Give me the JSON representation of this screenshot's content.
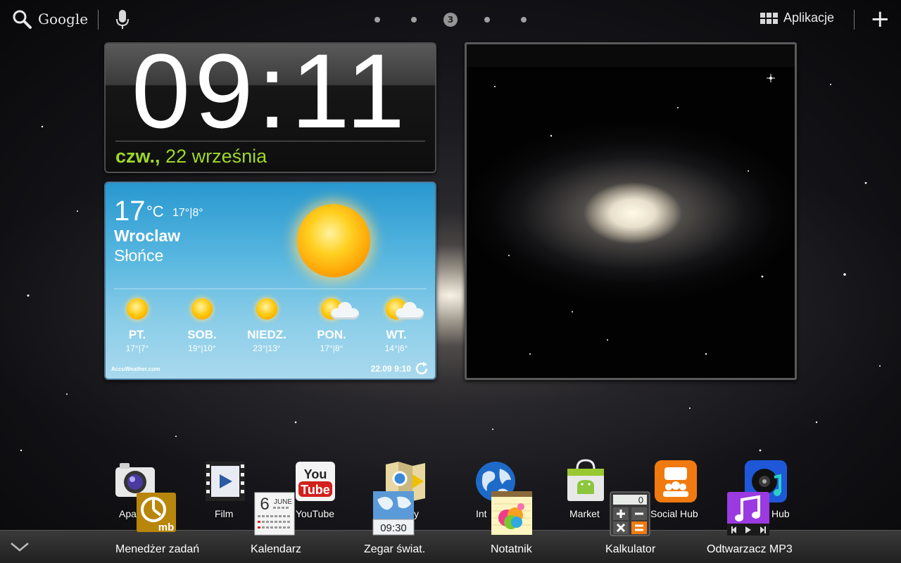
{
  "topbar": {
    "search_label": "Google",
    "page_indicator": "3",
    "apps_label": "Aplikacje",
    "add_label": "+"
  },
  "clock": {
    "time": "09:11",
    "day": "czw.,",
    "date": "22 września"
  },
  "weather": {
    "temp": "17",
    "unit": "°C",
    "hi_lo": "17°|8°",
    "city": "Wroclaw",
    "condition": "Słońce",
    "forecast": [
      {
        "day": "PT.",
        "temps": "17°|7°",
        "icon": "sunny-icon"
      },
      {
        "day": "SOB.",
        "temps": "19°|10°",
        "icon": "sunny-icon"
      },
      {
        "day": "NIEDZ.",
        "temps": "23°|13°",
        "icon": "sunny-icon"
      },
      {
        "day": "PON.",
        "temps": "17°|8°",
        "icon": "partly-cloudy-icon"
      },
      {
        "day": "WT.",
        "temps": "14°|6°",
        "icon": "partly-cloudy-icon"
      }
    ],
    "brand": "AccuWeather.com",
    "updated": "22.09 9:10"
  },
  "dock": {
    "row1": [
      {
        "label": "Apa",
        "icon": "camera-icon"
      },
      {
        "label": "Film",
        "icon": "video-icon"
      },
      {
        "label": "YouTube",
        "icon": "youtube-icon"
      },
      {
        "label": "y",
        "icon": "maps-icon"
      },
      {
        "label": "Int",
        "icon": "internet-icon"
      },
      {
        "label": "Market",
        "icon": "market-icon"
      },
      {
        "label": "Social Hub",
        "icon": "social-hub-icon"
      },
      {
        "label": "Hub",
        "icon": "music-hub-icon"
      }
    ],
    "row2": [
      {
        "label": "Menedżer zadań",
        "icon": "task-manager-icon",
        "icon_text": "mb"
      },
      {
        "label": "Kalendarz",
        "icon": "calendar-icon",
        "icon_day": "6",
        "icon_month": "JUNE"
      },
      {
        "label": "Zegar świat.",
        "icon": "world-clock-icon",
        "icon_time": "09:30"
      },
      {
        "label": "Notatnik",
        "icon": "notes-icon"
      },
      {
        "label": "Kalkulator",
        "icon": "calculator-icon",
        "icon_display": "0"
      },
      {
        "label": "Odtwarzacz MP3",
        "icon": "mp3-player-icon"
      }
    ]
  },
  "colors": {
    "date_green": "#9ed72b",
    "weather_blue": "#2898d0"
  }
}
